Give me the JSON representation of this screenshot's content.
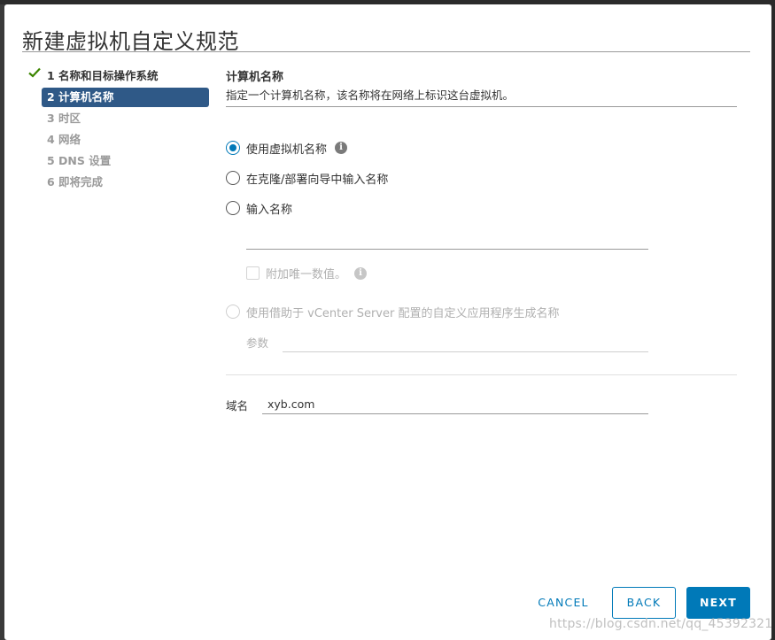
{
  "dialog": {
    "title": "新建虚拟机自定义规范"
  },
  "steps": [
    {
      "label": "1 名称和目标操作系统",
      "state": "done"
    },
    {
      "label": "2 计算机名称",
      "state": "active"
    },
    {
      "label": "3 时区",
      "state": "pending"
    },
    {
      "label": "4 网络",
      "state": "pending"
    },
    {
      "label": "5 DNS 设置",
      "state": "pending"
    },
    {
      "label": "6 即将完成",
      "state": "pending"
    }
  ],
  "section": {
    "title": "计算机名称",
    "description": "指定一个计算机名称，该名称将在网络上标识这台虚拟机。"
  },
  "options": {
    "use_vm_name": {
      "label": "使用虚拟机名称",
      "selected": true
    },
    "enter_in_wizard": {
      "label": "在克隆/部署向导中输入名称",
      "selected": false
    },
    "enter_name": {
      "label": "输入名称",
      "selected": false,
      "value": ""
    },
    "append_unique": {
      "label": "附加唯一数值。",
      "checked": false
    },
    "vcenter_app": {
      "label": "使用借助于 vCenter Server 配置的自定义应用程序生成名称",
      "selected": false
    },
    "param_label": "参数",
    "param_value": ""
  },
  "domain": {
    "label": "域名",
    "value": "xyb.com"
  },
  "buttons": {
    "cancel": "CANCEL",
    "back": "BACK",
    "next": "NEXT"
  },
  "watermark": "https://blog.csdn.net/qq_45392321",
  "colors": {
    "accent": "#0079b8",
    "active_step": "#2f5987",
    "check": "#3c8500"
  }
}
